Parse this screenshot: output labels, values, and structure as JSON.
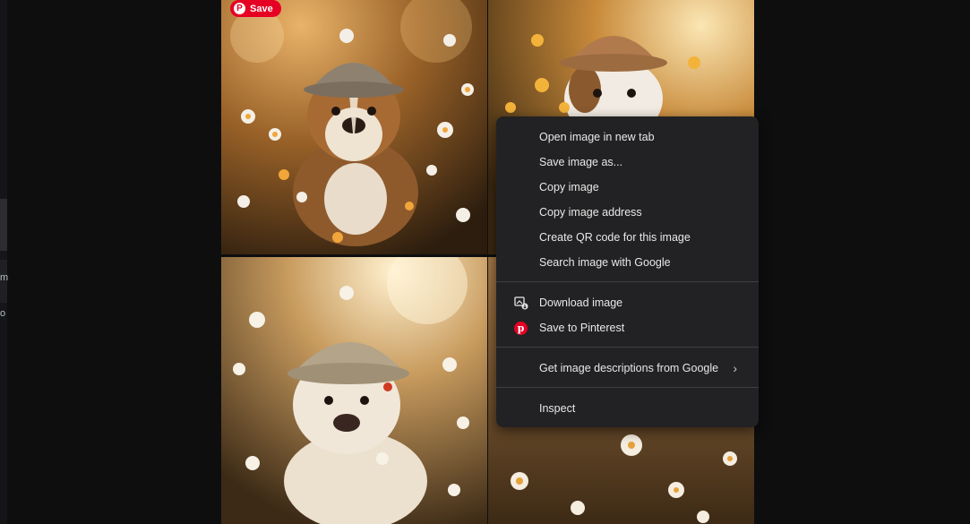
{
  "pinterest_button": {
    "label": "Save",
    "icon": "pinterest-logo-icon",
    "color": "#e60023"
  },
  "left_strip": {
    "glyphs": [
      "m",
      "o"
    ]
  },
  "gallery": {
    "images": [
      {
        "name": "bulldog-puppy-brown-white-cap"
      },
      {
        "name": "bulldog-puppy-orange-hat"
      },
      {
        "name": "bulldog-puppy-cream-hat"
      },
      {
        "name": "flower-field-closeup"
      }
    ]
  },
  "context_menu": {
    "items": [
      {
        "label": "Open image in new tab"
      },
      {
        "label": "Save image as..."
      },
      {
        "label": "Copy image"
      },
      {
        "label": "Copy image address"
      },
      {
        "label": "Create QR code for this image"
      },
      {
        "label": "Search image with Google"
      },
      {
        "label": "Download image",
        "icon": "download-image-icon"
      },
      {
        "label": "Save to Pinterest",
        "icon": "pinterest-icon"
      },
      {
        "label": "Get image descriptions from Google",
        "submenu": true
      },
      {
        "label": "Inspect"
      }
    ],
    "colors": {
      "background": "#222224",
      "text": "#e8e8e8",
      "separator": "#3f3f42"
    }
  }
}
